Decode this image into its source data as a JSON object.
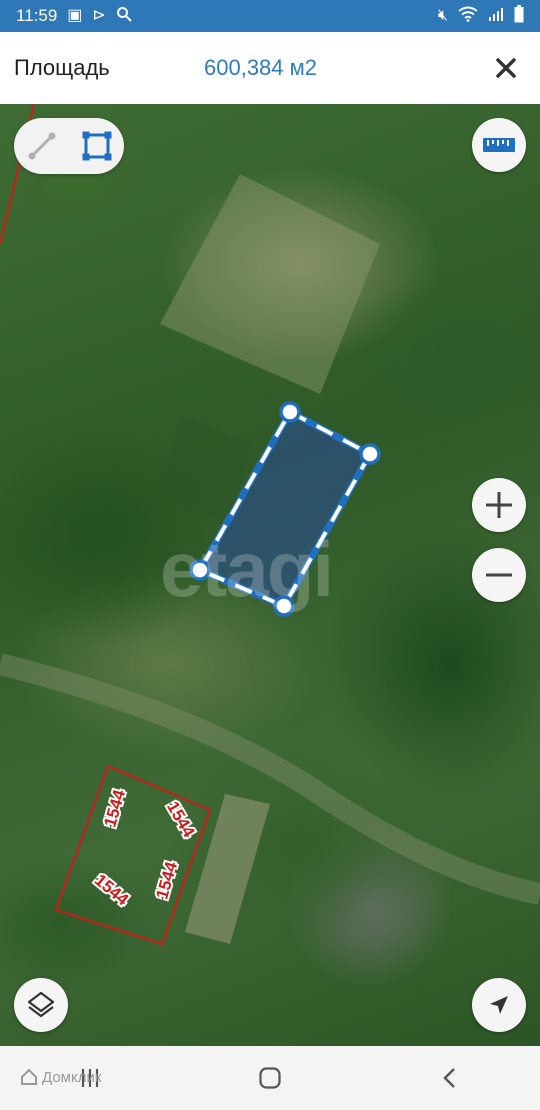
{
  "status_bar": {
    "time": "11:59",
    "left_icons": [
      "image-icon",
      "play-icon",
      "search-icon"
    ],
    "right_icons": [
      "mute-icon",
      "wifi-icon",
      "signal-icon",
      "battery-icon"
    ]
  },
  "header": {
    "label": "Площадь",
    "value": "600,384 м2",
    "close_icon": "close-icon"
  },
  "map": {
    "watermark": "etagi",
    "parcel_labels": [
      "1544",
      "1544",
      "1544",
      "1544"
    ],
    "colors": {
      "polygon_stroke": "#1f6fc1",
      "polygon_fill": "#2a4a9a",
      "parcel_border": "#d11a1a",
      "label_text": "#d11a1a"
    }
  },
  "controls": {
    "mode_line_icon": "line-measure-icon",
    "mode_area_icon": "area-measure-icon",
    "ruler_icon": "ruler-icon",
    "zoom_in_icon": "zoom-in-icon",
    "zoom_out_icon": "zoom-out-icon",
    "layers_icon": "layers-icon",
    "location_icon": "location-arrow-icon"
  },
  "nav_bar": {
    "watermark": "Домклик",
    "recent_icon": "recent-apps-icon",
    "home_icon": "home-icon",
    "back_icon": "back-icon"
  }
}
